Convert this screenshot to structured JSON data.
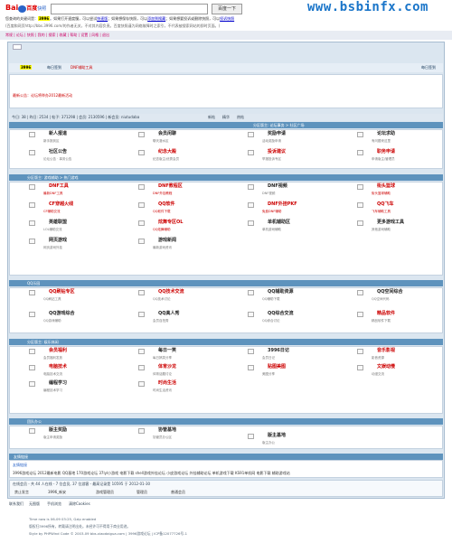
{
  "cache_header": {
    "logo_text": "Bai",
    "logo_sub": "百度",
    "logo_suffix": "快照",
    "search_button": "百度一下",
    "line1_pre": "您查询的关键词是：",
    "keyword": "3996",
    "line1_mid": "。如果打开速度慢，可以尝试",
    "fast_link": "快速版",
    "line1_mid2": "；如果想保存快照，可以",
    "save_link": "添加到搜藏",
    "line1_mid3": "；如果想要投诉或删除快照，可以",
    "report_link": "投诉快照",
    "line2": "(百度和网页http://bbs.3996.com/的作者无关，不对其内容负责。百度快照谨为网络故障时之索引，不代表被搜索网站的即时页面。)",
    "watermark": "www.bsbinfx.com"
  },
  "top_nav_links": "常规 | 论坛 | 快照 | 我的 | 搜索 | 收藏 | 帮助 | 设置 | 风格 | 退出",
  "site": {
    "logo": "3996",
    "nav_items": [
      "每日签到",
      "DNF辅助工具"
    ],
    "nav_right": [
      "更多",
      "注册"
    ],
    "announcement": "最新公告：论坛将举办2012最新活动"
  },
  "stats_bar": {
    "text": "今日: 38 | 昨日: 2534 | 帖子: 371298 | 会员: 2130596 | 新会员: niutudaba",
    "right_links": [
      "新帖",
      "精华",
      "热帖",
      "排行"
    ]
  },
  "sections": [
    {
      "header": "分区版主: 论坛事务 > 社区广场",
      "forums": [
        {
          "name": "新人报道",
          "desc": "新手报到区",
          "red": false
        },
        {
          "name": "会员闲聊",
          "desc": "聊天灌水区",
          "red": false
        },
        {
          "name": "奖励申请",
          "desc": "活动奖励申请",
          "red": false
        },
        {
          "name": "论坛求助",
          "desc": "有问题来这里",
          "red": false
        },
        {
          "name": "社区公告",
          "desc": "论坛公告 · 事务公告",
          "red": false
        },
        {
          "name": "纪念大殿",
          "desc": "纪念版主/优秀会员",
          "red": true
        },
        {
          "name": "投诉建议",
          "desc": "举报投诉专区",
          "red": true
        },
        {
          "name": "职务申请",
          "desc": "申请版主/管理员",
          "red": true
        }
      ]
    },
    {
      "header": "分区版主: 游戏辅助 > 热门游戏",
      "forums": [
        {
          "name": "DNF工具",
          "desc": "最新DNF工具",
          "red": true
        },
        {
          "name": "DNF教程区",
          "desc": "DNF外挂教程",
          "red": true
        },
        {
          "name": "DNF视频",
          "desc": "DNF视频",
          "red": false
        },
        {
          "name": "街头篮球",
          "desc": "街头篮球辅助",
          "red": true
        },
        {
          "name": "CF穿越火线",
          "desc": "CF辅助交流",
          "red": true
        },
        {
          "name": "QQ软件",
          "desc": "QQ软件下载",
          "red": true
        },
        {
          "name": "DNF外挂PKF",
          "desc": "免费DNF辅助",
          "red": true
        },
        {
          "name": "QQ飞车",
          "desc": "飞车辅助工具",
          "red": true
        },
        {
          "name": "英雄联盟",
          "desc": "LOL辅助交流",
          "red": false
        },
        {
          "name": "炫舞专区OL",
          "desc": "QQ炫舞辅助",
          "red": true
        },
        {
          "name": "单机辅助区",
          "desc": "单机游戏辅助",
          "red": false
        },
        {
          "name": "更多游戏工具",
          "desc": "其他游戏辅助",
          "red": false
        },
        {
          "name": "网页游戏",
          "desc": "网页游戏外挂",
          "red": false
        },
        {
          "name": "游戏新闻",
          "desc": "最新游戏资讯",
          "red": false
        }
      ]
    },
    {
      "header": "QQ乐园",
      "forums": [
        {
          "name": "QQ刷钻专区",
          "desc": "QQ刷钻工具",
          "red": true
        },
        {
          "name": "QQ技术交流",
          "desc": "QQ技术讨论",
          "red": true
        },
        {
          "name": "QQ辅助资源",
          "desc": "QQ辅助下载",
          "red": false
        },
        {
          "name": "QQ空间综合",
          "desc": "QQ空间代码",
          "red": false
        },
        {
          "name": "QQ游戏综合",
          "desc": "QQ游戏辅助",
          "red": false
        },
        {
          "name": "QQ真人秀",
          "desc": "会员自拍秀",
          "red": false
        },
        {
          "name": "QQ综合交流",
          "desc": "QQ综合讨论",
          "red": false
        },
        {
          "name": "精品软件",
          "desc": "精品软件下载",
          "red": true
        }
      ]
    },
    {
      "header": "分区版主: 娱乐休闲",
      "forums": [
        {
          "name": "会员福利",
          "desc": "会员福利发放",
          "red": true
        },
        {
          "name": "每日一笑",
          "desc": "每日搞笑分享",
          "red": false
        },
        {
          "name": "3996日记",
          "desc": "会员日记",
          "red": false
        },
        {
          "name": "音乐影视",
          "desc": "影音资源",
          "red": true
        },
        {
          "name": "电脑技术",
          "desc": "电脑技术交流",
          "red": true
        },
        {
          "name": "体育沙龙",
          "desc": "体育话题讨论",
          "red": true
        },
        {
          "name": "贴图美图",
          "desc": "美图分享",
          "red": true
        },
        {
          "name": "文娱动慢",
          "desc": "动漫交流",
          "red": true
        },
        {
          "name": "编程学习",
          "desc": "编程技术学习",
          "red": false
        },
        {
          "name": "时尚生活",
          "desc": "时尚生活资讯",
          "red": true
        }
      ]
    },
    {
      "header": "团队办公",
      "forums": [
        {
          "name": "版主奖励",
          "desc": "版主申请奖励",
          "red": false
        },
        {
          "name": "协管基地",
          "desc": "协管员办公区",
          "red": false
        },
        {
          "name": "版主基地",
          "desc": "版主办公",
          "red": false
        }
      ]
    }
  ],
  "links_section": {
    "header": "友情链接",
    "sub": "友情链接",
    "links": "3996游戏论坛  2012最新电影  QQ基地  170游戏论坛  37lyl小游戏  电影下载  shell游戏外挂论坛  小皮游戏论坛  外挂辅助论坛  单机游戏下载  KS91单机网  电影下载  辅助游戏站"
  },
  "online": {
    "text": "在线会员 - 共 44 人在线 - 7 位会员, 37 位游客 - 最高记录是 10595 于 2012-01-30",
    "groups": [
      "禁止发言",
      "3996_新安",
      "游戏管理员",
      "管理员",
      "普通会员"
    ]
  },
  "bottom_links": [
    "联系我们",
    "无图版",
    "手机浏览",
    "清除Cookies"
  ],
  "footer": {
    "line1": "Time now is 06-09 03:25, Gzip enabled",
    "line2": "版权归3996所有，转载请注明出处。未经许可不得用于商业用途。",
    "line3": "Style by PHPWind Code © 2003-09 bbs.xiaodaigua.com | 3996游戏论坛 | ICP备12077726号-1"
  }
}
